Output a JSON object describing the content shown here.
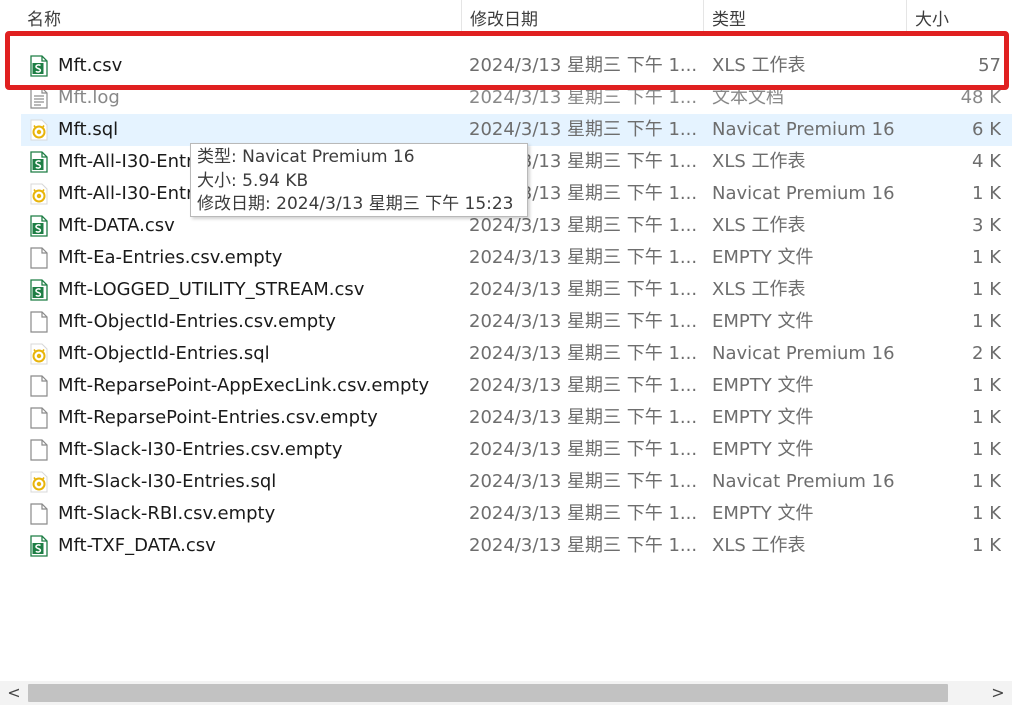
{
  "columns": {
    "name": "名称",
    "date": "修改日期",
    "type": "类型",
    "size": "大小",
    "sort_arrow": "^"
  },
  "files": [
    {
      "name": "Mft.csv",
      "date": "2024/3/13 星期三 下午 1...",
      "type": "XLS 工作表",
      "size": "57",
      "icon": "csv-spreadsheet-icon"
    },
    {
      "name": "Mft.log",
      "date": "2024/3/13 星期三 下午 1...",
      "type": "文本文档",
      "size": "48 K",
      "icon": "text-document-icon"
    },
    {
      "name": "Mft.sql",
      "date": "2024/3/13 星期三 下午 1...",
      "type": "Navicat Premium 16",
      "size": "6 K",
      "icon": "navicat-sql-icon"
    },
    {
      "name": "Mft-All-I30-Entries.csv",
      "date": "2024/3/13 星期三 下午 1...",
      "type": "XLS 工作表",
      "size": "4 K",
      "icon": "csv-spreadsheet-icon"
    },
    {
      "name": "Mft-All-I30-Entries.sql",
      "date": "2024/3/13 星期三 下午 1...",
      "type": "Navicat Premium 16",
      "size": "1 K",
      "icon": "navicat-sql-icon"
    },
    {
      "name": "Mft-DATA.csv",
      "date": "2024/3/13 星期三 下午 1...",
      "type": "XLS 工作表",
      "size": "3 K",
      "icon": "csv-spreadsheet-icon"
    },
    {
      "name": "Mft-Ea-Entries.csv.empty",
      "date": "2024/3/13 星期三 下午 1...",
      "type": "EMPTY 文件",
      "size": "1 K",
      "icon": "blank-file-icon"
    },
    {
      "name": "Mft-LOGGED_UTILITY_STREAM.csv",
      "date": "2024/3/13 星期三 下午 1...",
      "type": "XLS 工作表",
      "size": "1 K",
      "icon": "csv-spreadsheet-icon"
    },
    {
      "name": "Mft-ObjectId-Entries.csv.empty",
      "date": "2024/3/13 星期三 下午 1...",
      "type": "EMPTY 文件",
      "size": "1 K",
      "icon": "blank-file-icon"
    },
    {
      "name": "Mft-ObjectId-Entries.sql",
      "date": "2024/3/13 星期三 下午 1...",
      "type": "Navicat Premium 16",
      "size": "2 K",
      "icon": "navicat-sql-icon"
    },
    {
      "name": "Mft-ReparsePoint-AppExecLink.csv.empty",
      "date": "2024/3/13 星期三 下午 1...",
      "type": "EMPTY 文件",
      "size": "1 K",
      "icon": "blank-file-icon"
    },
    {
      "name": "Mft-ReparsePoint-Entries.csv.empty",
      "date": "2024/3/13 星期三 下午 1...",
      "type": "EMPTY 文件",
      "size": "1 K",
      "icon": "blank-file-icon"
    },
    {
      "name": "Mft-Slack-I30-Entries.csv.empty",
      "date": "2024/3/13 星期三 下午 1...",
      "type": "EMPTY 文件",
      "size": "1 K",
      "icon": "blank-file-icon"
    },
    {
      "name": "Mft-Slack-I30-Entries.sql",
      "date": "2024/3/13 星期三 下午 1...",
      "type": "Navicat Premium 16",
      "size": "1 K",
      "icon": "navicat-sql-icon"
    },
    {
      "name": "Mft-Slack-RBI.csv.empty",
      "date": "2024/3/13 星期三 下午 1...",
      "type": "EMPTY 文件",
      "size": "1 K",
      "icon": "blank-file-icon"
    },
    {
      "name": "Mft-TXF_DATA.csv",
      "date": "2024/3/13 星期三 下午 1...",
      "type": "XLS 工作表",
      "size": "1 K",
      "icon": "csv-spreadsheet-icon"
    }
  ],
  "tooltip": {
    "line1": "类型: Navicat Premium 16",
    "line2": "大小: 5.94 KB",
    "line3": "修改日期: 2024/3/13 星期三 下午 15:23"
  },
  "scrollbar": {
    "left_arrow": "<",
    "right_arrow": ">"
  },
  "colors": {
    "highlight_box": "#e02020",
    "hover_row": "#e5f3ff",
    "csv_icon_green": "#1e7e45",
    "sql_icon_yellow": "#e8b40a"
  }
}
